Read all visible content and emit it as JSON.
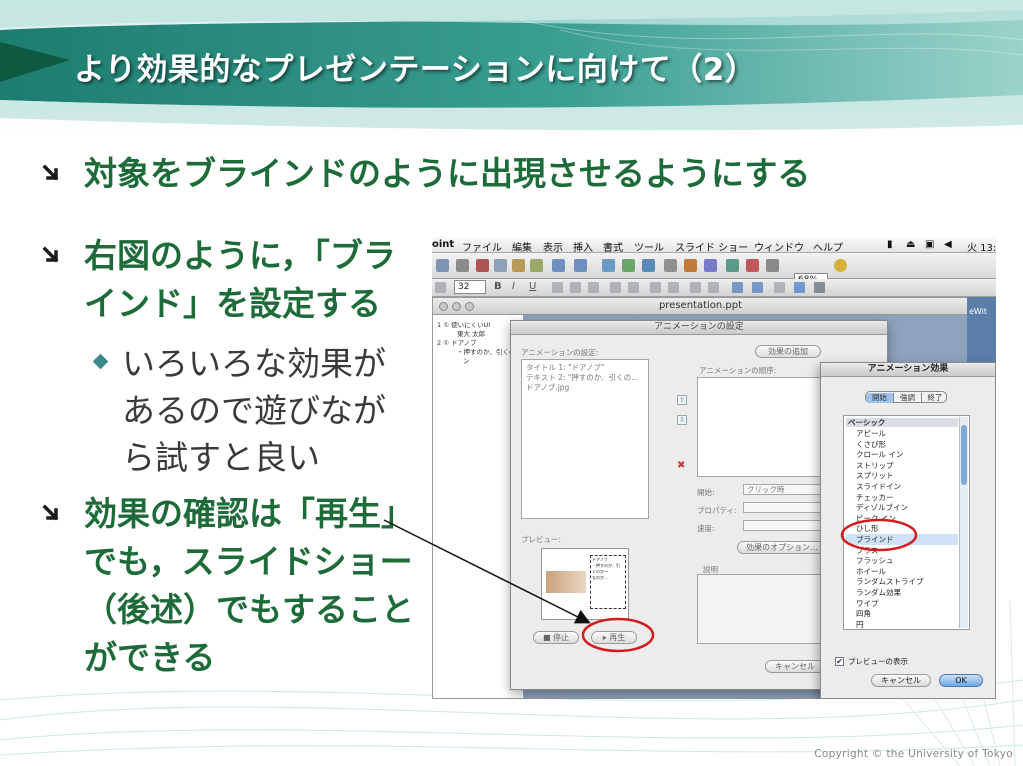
{
  "slide": {
    "title": "より効果的なプレゼンテーションに向けて（2）",
    "bullets": [
      "対象をブラインドのように出現させるようにする",
      "右図のように，「ブラインド」を設定する",
      "効果の確認は「再生」でも，スライドショー（後述）でもすることができる"
    ],
    "sub_bullet": "いろいろな効果があるので遊びながら試すと良い",
    "copyright": "Copyright © the University of Tokyo"
  },
  "colors": {
    "title_band": "#2f8f8a",
    "bullet_text": "#1e6b3a",
    "highlight_ellipse": "#d21c1c"
  },
  "screenshot": {
    "menubar": {
      "app": "oint",
      "items": [
        "ファイル",
        "編集",
        "表示",
        "挿入",
        "書式",
        "ツール",
        "スライド ショー",
        "ウィンドウ",
        "ヘルプ"
      ],
      "clock": "火 13:"
    },
    "toolbar": {
      "zoom": "68%",
      "font_size": "32"
    },
    "window_title": "presentation.ppt",
    "desktop_label": "eWit",
    "outline": {
      "line1": "1 ① 使いにくいUI",
      "line2": "東大 太郎",
      "line3": "2 ① ドアノブ",
      "line4": "・押すのか、引くの",
      "line5": "ン"
    },
    "anim_dialog": {
      "title": "アニメーションの設定",
      "settings_label": "アニメーションの設定:",
      "add_effect": "効果の追加",
      "order_label": "アニメーションの順序:",
      "items": [
        "タイトル 1: \"ドアノブ\"",
        "テキスト 2: \"押すのか、引くの...",
        "ドアノブ.jpg"
      ],
      "start_label": "開始:",
      "start_value": "クリック時",
      "property_label": "プロパティ:",
      "speed_label": "速度:",
      "effect_options": "効果のオプション...",
      "preview_label": "プレビュー:",
      "description_label": "説明",
      "stop": "停止",
      "play": "再生",
      "cancel": "キャンセル",
      "preview_lines": [
        "ドアノブ",
        "・押すのか、引",
        "くのか～",
        "なのか..."
      ]
    },
    "effects_dialog": {
      "title": "アニメーション効果",
      "tabs": [
        "開始",
        "強調",
        "終了"
      ],
      "category": "ベーシック",
      "items": [
        "アピール",
        "くさび形",
        "クロール イン",
        "ストリップ",
        "スプリット",
        "スライドイン",
        "チェッカー",
        "ディゾルブイン",
        "ピーク イン",
        "ひし形",
        "ブラインド",
        "プラス",
        "フラッシュ",
        "ホイール",
        "ランダムストライプ",
        "ランダム効果",
        "ワイプ",
        "四角",
        "円"
      ],
      "selected": "ブラインド",
      "preview_checkbox": "プレビューの表示",
      "preview_checked": true,
      "cancel": "キャンセル",
      "ok": "OK"
    }
  }
}
